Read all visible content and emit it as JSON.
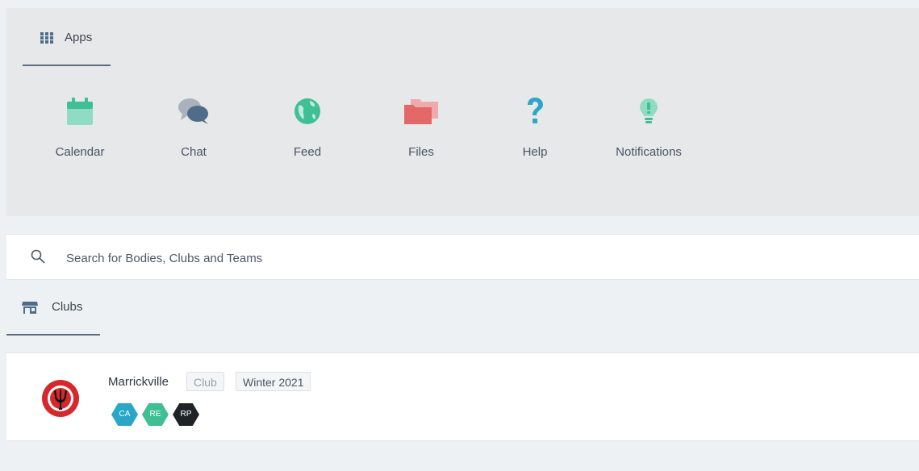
{
  "apps_panel": {
    "tab": {
      "label": "Apps",
      "icon": "grid-icon"
    },
    "items": [
      {
        "label": "Calendar",
        "icon": "calendar-icon",
        "color": "#6fcdb0"
      },
      {
        "label": "Chat",
        "icon": "chat-icon",
        "color": "#4f6d88"
      },
      {
        "label": "Feed",
        "icon": "globe-icon",
        "color": "#3fbf94"
      },
      {
        "label": "Files",
        "icon": "folder-icon",
        "color": "#e46868"
      },
      {
        "label": "Help",
        "icon": "question-icon",
        "color": "#2aa6c8"
      },
      {
        "label": "Notifications",
        "icon": "lightbulb-icon",
        "color": "#3fbf94"
      }
    ]
  },
  "search": {
    "placeholder": "Search for Bodies, Clubs and Teams",
    "value": "",
    "icon": "search-icon"
  },
  "clubs_section": {
    "tab": {
      "label": "Clubs",
      "icon": "storefront-icon"
    },
    "clubs": [
      {
        "name": "Marrickville",
        "type_tag": "Club",
        "season_tag": "Winter 2021",
        "logo": "trident-crest-logo",
        "badges": [
          {
            "label": "CA",
            "color": "#2aa6c8"
          },
          {
            "label": "RE",
            "color": "#3fbf94"
          },
          {
            "label": "RP",
            "color": "#1f2327"
          }
        ]
      }
    ]
  }
}
